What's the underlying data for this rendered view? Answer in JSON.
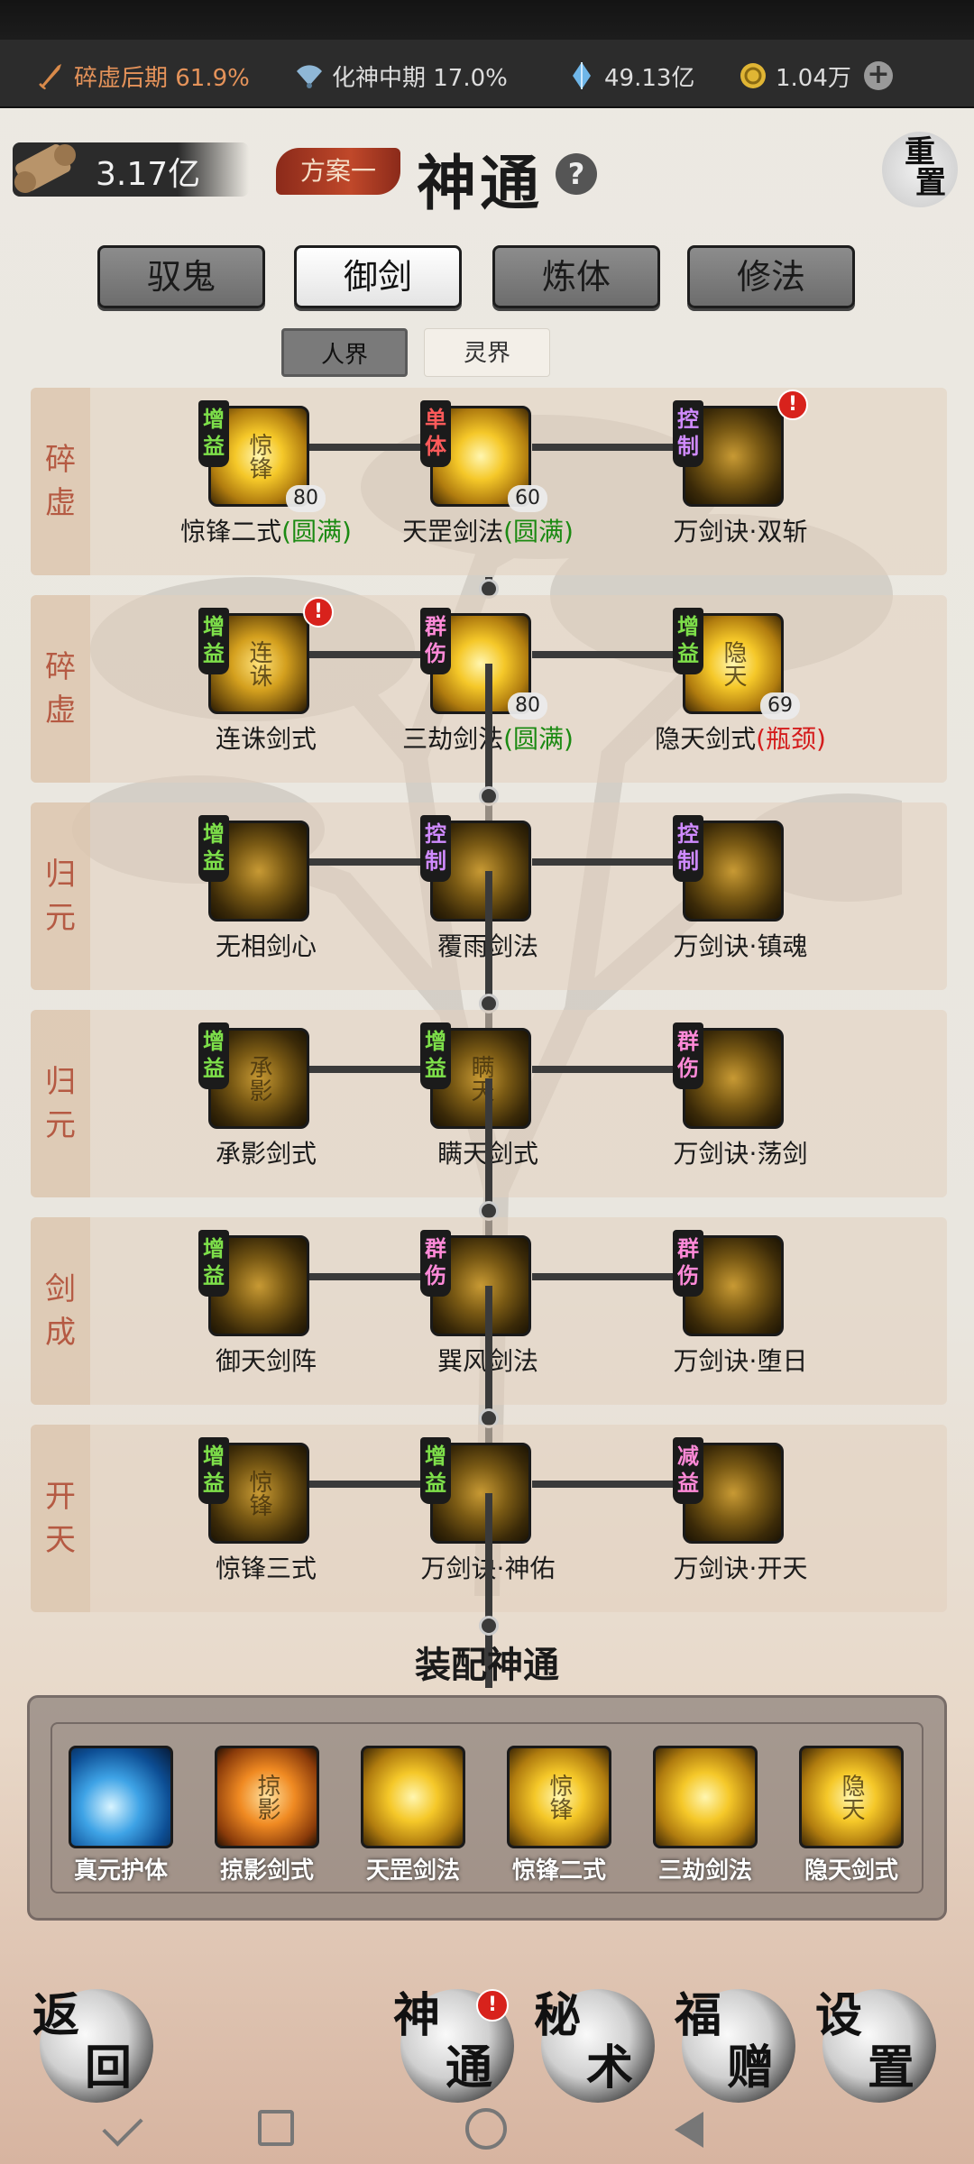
{
  "status": {
    "cultivation1": "碎虚后期 61.9%",
    "cultivation2": "化神中期 17.0%",
    "spirit_stones": "49.13亿",
    "coins": "1.04万",
    "accent_color": "#e5935a"
  },
  "header": {
    "resource": "3.17亿",
    "plan": "方案一",
    "title": "神通",
    "reset_line1": "重",
    "reset_line2": "置"
  },
  "tabs": [
    "驭鬼",
    "御剑",
    "炼体",
    "修法"
  ],
  "active_tab": "御剑",
  "subtabs": [
    "人界",
    "灵界"
  ],
  "active_subtab": "人界",
  "rows": [
    {
      "label": [
        "碎",
        "虚"
      ],
      "skills": [
        {
          "tag": [
            "增",
            "益"
          ],
          "tag_color": "green",
          "name": "惊锋二式",
          "suffix": "(圆满)",
          "suffix_color": "green",
          "level": "80",
          "alert": false,
          "icon": "bright",
          "glyph": "惊锋"
        },
        {
          "tag": [
            "单",
            "体"
          ],
          "tag_color": "red",
          "name": "天罡剑法",
          "suffix": "(圆满)",
          "suffix_color": "green",
          "level": "60",
          "alert": false,
          "icon": "bright",
          "glyph": ""
        },
        {
          "tag": [
            "控",
            "制"
          ],
          "tag_color": "purple",
          "name": "万剑诀·双斩",
          "suffix": "",
          "suffix_color": "",
          "level": "",
          "alert": true,
          "icon": "dark",
          "glyph": ""
        }
      ]
    },
    {
      "label": [
        "碎",
        "虚"
      ],
      "skills": [
        {
          "tag": [
            "增",
            "益"
          ],
          "tag_color": "green",
          "name": "连诛剑式",
          "suffix": "",
          "suffix_color": "",
          "level": "",
          "alert": true,
          "icon": "mid",
          "glyph": "连诛"
        },
        {
          "tag": [
            "群",
            "伤"
          ],
          "tag_color": "pink",
          "name": "三劫剑法",
          "suffix": "(圆满)",
          "suffix_color": "green",
          "level": "80",
          "alert": false,
          "icon": "bright",
          "glyph": ""
        },
        {
          "tag": [
            "增",
            "益"
          ],
          "tag_color": "green",
          "name": "隐天剑式",
          "suffix": "(瓶颈)",
          "suffix_color": "red",
          "level": "69",
          "alert": false,
          "icon": "bright",
          "glyph": "隐天"
        }
      ]
    },
    {
      "label": [
        "归",
        "元"
      ],
      "skills": [
        {
          "tag": [
            "增",
            "益"
          ],
          "tag_color": "green",
          "name": "无相剑心",
          "suffix": "",
          "suffix_color": "",
          "level": "",
          "alert": false,
          "icon": "dark",
          "glyph": ""
        },
        {
          "tag": [
            "控",
            "制"
          ],
          "tag_color": "purple",
          "name": "覆雨剑法",
          "suffix": "",
          "suffix_color": "",
          "level": "",
          "alert": false,
          "icon": "dark",
          "glyph": ""
        },
        {
          "tag": [
            "控",
            "制"
          ],
          "tag_color": "purple",
          "name": "万剑诀·镇魂",
          "suffix": "",
          "suffix_color": "",
          "level": "",
          "alert": false,
          "icon": "dark",
          "glyph": ""
        }
      ]
    },
    {
      "label": [
        "归",
        "元"
      ],
      "skills": [
        {
          "tag": [
            "增",
            "益"
          ],
          "tag_color": "green",
          "name": "承影剑式",
          "suffix": "",
          "suffix_color": "",
          "level": "",
          "alert": false,
          "icon": "dark",
          "glyph": "承影"
        },
        {
          "tag": [
            "增",
            "益"
          ],
          "tag_color": "green",
          "name": "瞒天剑式",
          "suffix": "",
          "suffix_color": "",
          "level": "",
          "alert": false,
          "icon": "dark",
          "glyph": "瞒天"
        },
        {
          "tag": [
            "群",
            "伤"
          ],
          "tag_color": "pink",
          "name": "万剑诀·荡剑",
          "suffix": "",
          "suffix_color": "",
          "level": "",
          "alert": false,
          "icon": "dark",
          "glyph": ""
        }
      ]
    },
    {
      "label": [
        "剑",
        "成"
      ],
      "skills": [
        {
          "tag": [
            "增",
            "益"
          ],
          "tag_color": "green",
          "name": "御天剑阵",
          "suffix": "",
          "suffix_color": "",
          "level": "",
          "alert": false,
          "icon": "dark",
          "glyph": ""
        },
        {
          "tag": [
            "群",
            "伤"
          ],
          "tag_color": "pink",
          "name": "巽风剑法",
          "suffix": "",
          "suffix_color": "",
          "level": "",
          "alert": false,
          "icon": "dark",
          "glyph": ""
        },
        {
          "tag": [
            "群",
            "伤"
          ],
          "tag_color": "pink",
          "name": "万剑诀·堕日",
          "suffix": "",
          "suffix_color": "",
          "level": "",
          "alert": false,
          "icon": "dark",
          "glyph": ""
        }
      ]
    },
    {
      "label": [
        "开",
        "天"
      ],
      "skills": [
        {
          "tag": [
            "增",
            "益"
          ],
          "tag_color": "green",
          "name": "惊锋三式",
          "suffix": "",
          "suffix_color": "",
          "level": "",
          "alert": false,
          "icon": "dark",
          "glyph": "惊锋"
        },
        {
          "tag": [
            "增",
            "益"
          ],
          "tag_color": "green",
          "name": "万剑诀·神佑",
          "suffix": "",
          "suffix_color": "",
          "level": "",
          "alert": false,
          "icon": "dark",
          "glyph": ""
        },
        {
          "tag": [
            "减",
            "益"
          ],
          "tag_color": "pink",
          "name": "万剑诀·开天",
          "suffix": "",
          "suffix_color": "",
          "level": "",
          "alert": false,
          "icon": "dark",
          "glyph": ""
        }
      ]
    }
  ],
  "equip": {
    "title": "装配神通",
    "items": [
      {
        "name": "真元护体",
        "icon": "blue",
        "glyph": ""
      },
      {
        "name": "掠影剑式",
        "icon": "orange",
        "glyph": "掠影"
      },
      {
        "name": "天罡剑法",
        "icon": "bright",
        "glyph": ""
      },
      {
        "name": "惊锋二式",
        "icon": "bright",
        "glyph": "惊锋"
      },
      {
        "name": "三劫剑法",
        "icon": "bright",
        "glyph": ""
      },
      {
        "name": "隐天剑式",
        "icon": "bright",
        "glyph": "隐天"
      }
    ]
  },
  "nav": [
    {
      "c1": "返",
      "c2": "回"
    },
    {
      "c1": "神",
      "c2": "通"
    },
    {
      "c1": "秘",
      "c2": "术"
    },
    {
      "c1": "福",
      "c2": "赠"
    },
    {
      "c1": "设",
      "c2": "置"
    }
  ]
}
